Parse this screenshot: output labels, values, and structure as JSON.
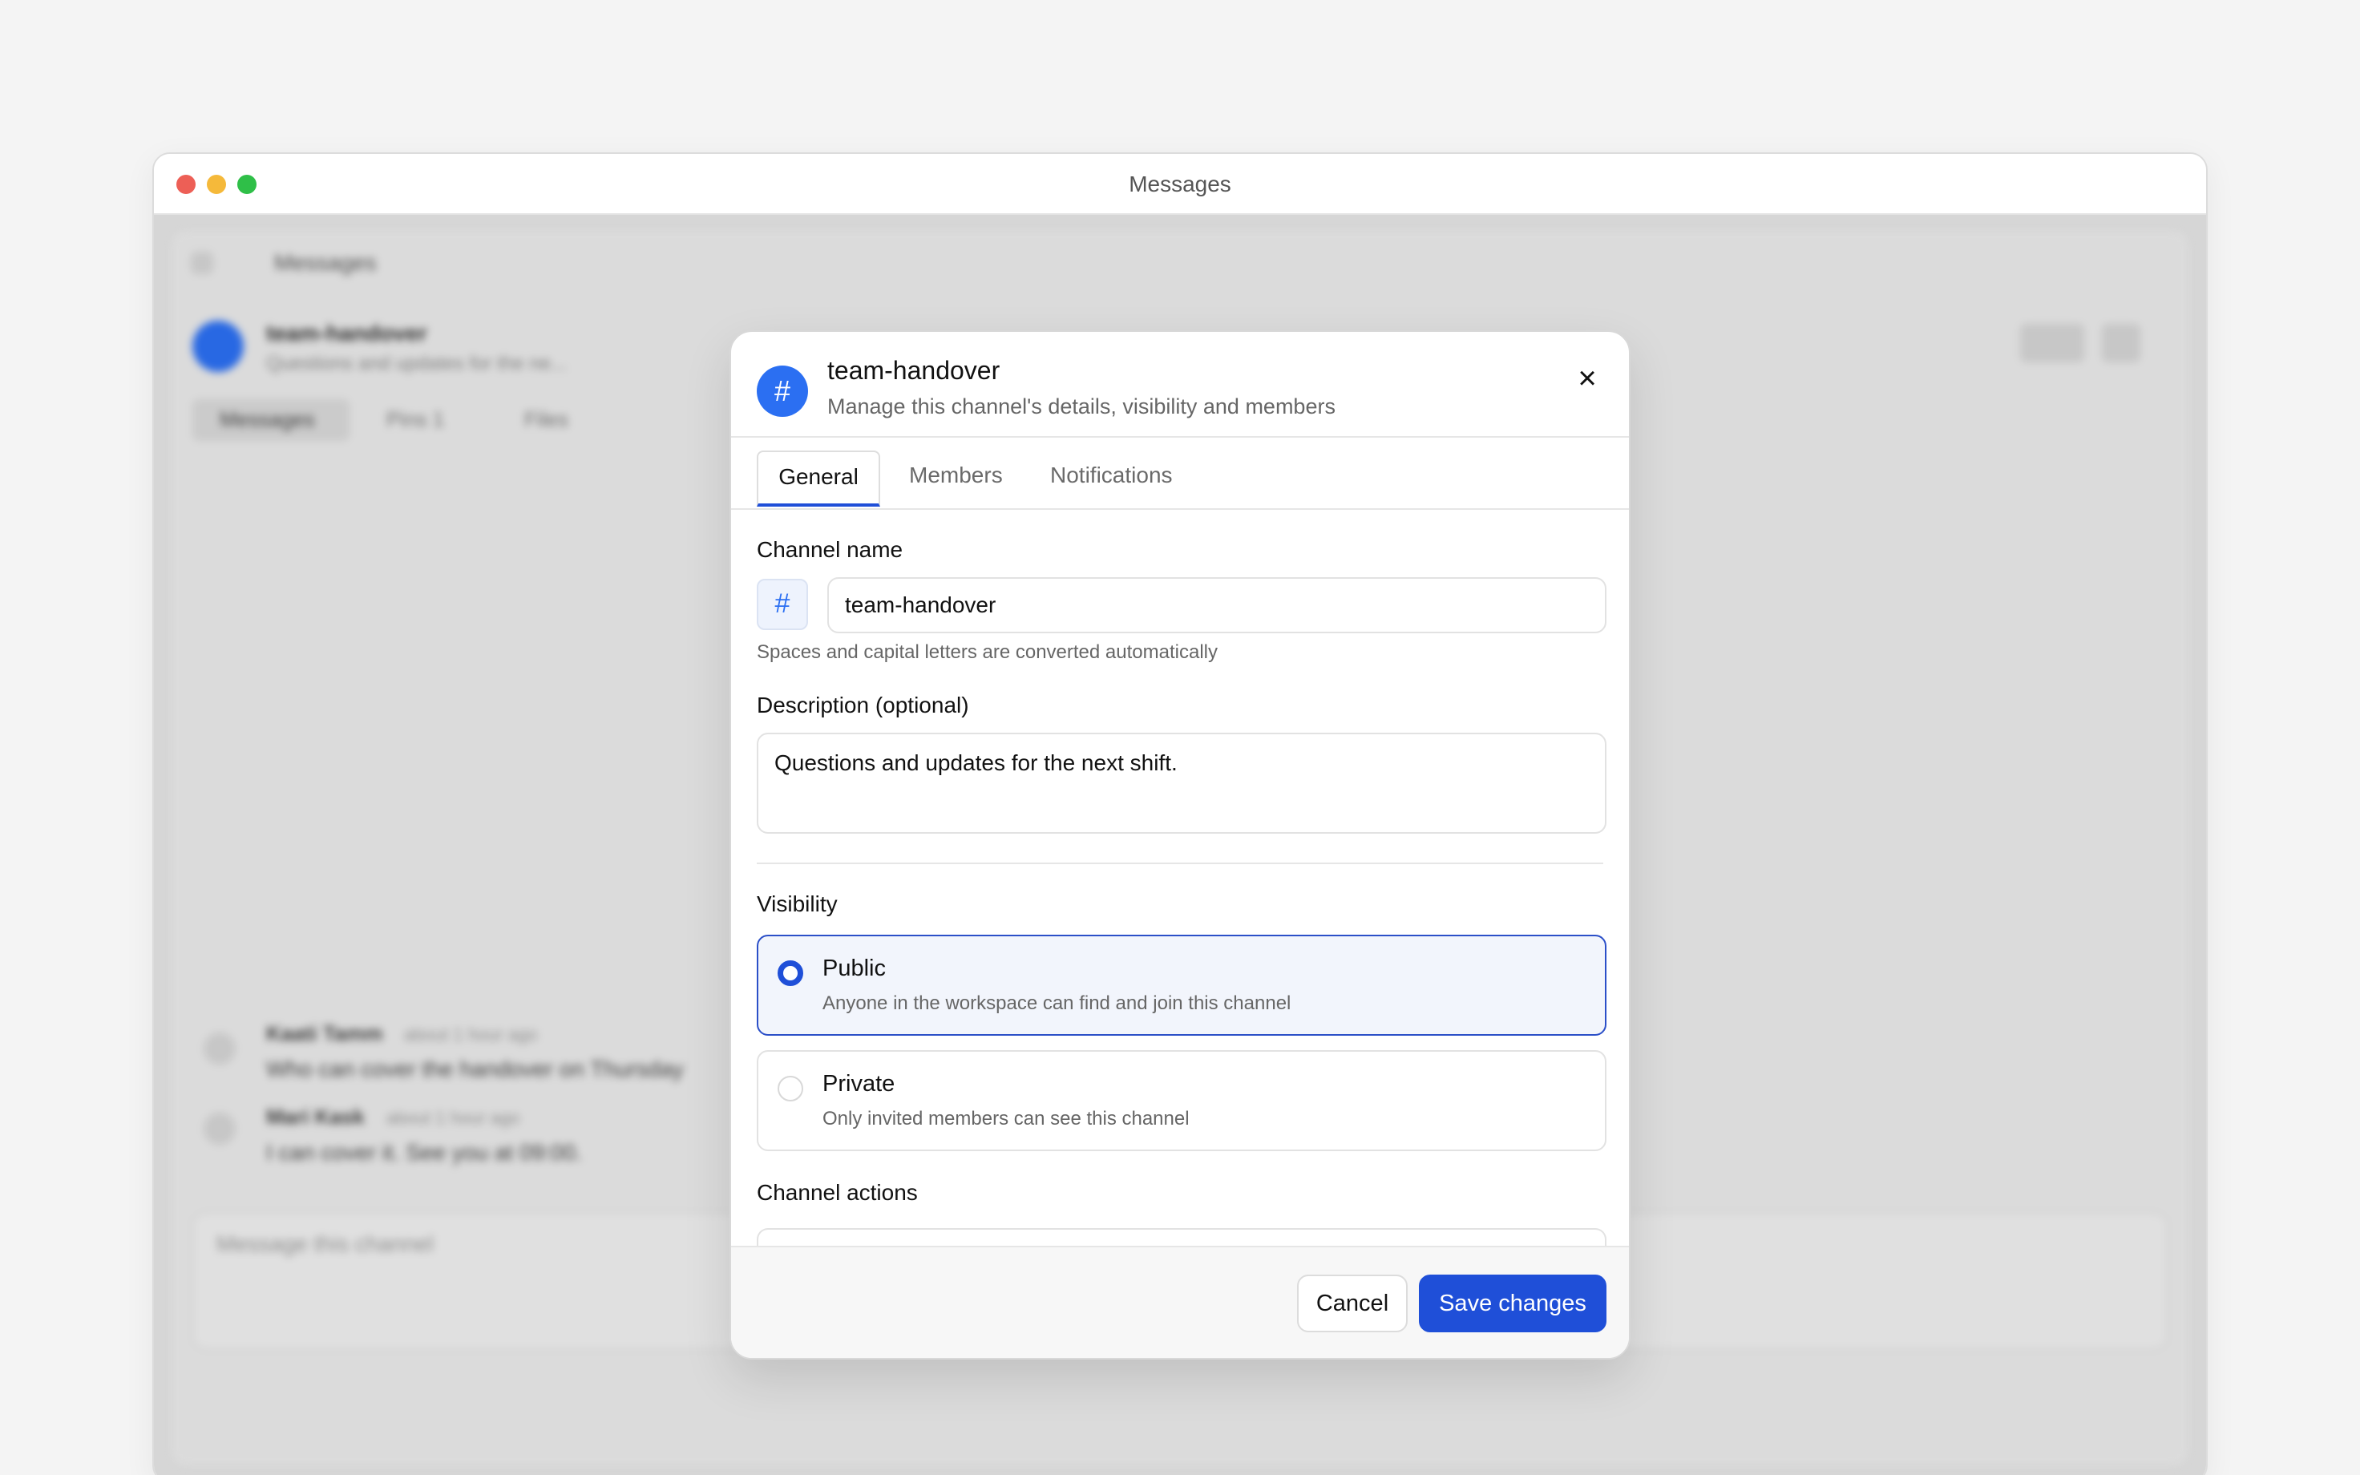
{
  "window": {
    "title": "Messages"
  },
  "background": {
    "topbar_title": "Messages",
    "channel_name": "team-handover",
    "channel_desc": "Questions and updates for the ne...",
    "tabs": [
      "Messages",
      "Pins 1",
      "Files"
    ],
    "messages": [
      {
        "author": "Kaati Tamm",
        "time": "about 1 hour ago",
        "text": "Who can cover the handover on Thursday"
      },
      {
        "author": "Mari Kask",
        "time": "about 1 hour ago",
        "text": "I can cover it. See you at 09:00."
      }
    ],
    "composer_placeholder": "Message this channel"
  },
  "modal": {
    "icon": "#",
    "title": "team-handover",
    "subtitle": "Manage this channel's details, visibility and members",
    "close_icon": "×",
    "tabs": [
      {
        "label": "General",
        "active": true
      },
      {
        "label": "Members",
        "active": false
      },
      {
        "label": "Notifications",
        "active": false
      }
    ],
    "channel_name_label": "Channel name",
    "channel_name_prefix": "#",
    "channel_name_value": "team-handover",
    "channel_name_hint": "Spaces and capital letters are converted automatically",
    "description_label": "Description (optional)",
    "description_value": "Questions and updates for the next shift.",
    "visibility_label": "Visibility",
    "visibility_options": [
      {
        "title": "Public",
        "description": "Anyone in the workspace can find and join this channel",
        "selected": true
      },
      {
        "title": "Private",
        "description": "Only invited members can see this channel",
        "selected": false
      }
    ],
    "channel_actions_label": "Channel actions",
    "cancel_label": "Cancel",
    "save_label": "Save changes"
  },
  "colors": {
    "accent": "#1f4fd8",
    "icon_blue": "#2b6ff2"
  }
}
